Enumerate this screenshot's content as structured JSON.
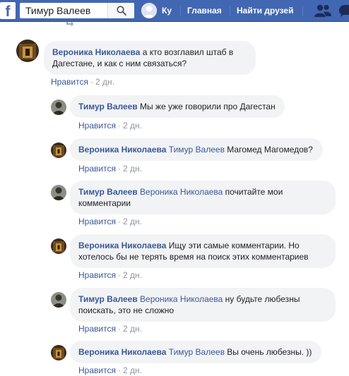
{
  "search": {
    "value": "Тимур Валеев"
  },
  "header": {
    "profile_label": "Ку",
    "home_label": "Главная",
    "find_friends_label": "Найти друзей"
  },
  "colors": {
    "topbar": "#4267b2",
    "link": "#385898",
    "bubble": "#f2f3f5",
    "muted": "#90949c"
  },
  "comments": [
    {
      "author": "Вероника Николаева",
      "mention": "",
      "text": " а кто возглавил штаб в Дагестане, и как с ним связаться?",
      "like": "Нравится",
      "time": "2 дн.",
      "avatar": "avatar-dark-photo"
    },
    {
      "author": "Тимур Валеев",
      "mention": "",
      "text": " Мы же уже говорили про Дагестан",
      "like": "Нравится",
      "time": "2 дн.",
      "avatar": "avatar-man-photo"
    },
    {
      "author": "Вероника Николаева",
      "mention": "Тимур Валеев",
      "text": " Магомед Магомедов?",
      "like": "Нравится",
      "time": "2 дн.",
      "avatar": "avatar-dark-photo"
    },
    {
      "author": "Тимур Валеев",
      "mention": "Вероника Николаева",
      "text": " почитайте мои комментарии",
      "like": "Нравится",
      "time": "2 дн.",
      "avatar": "avatar-man-photo"
    },
    {
      "author": "Вероника Николаева",
      "mention": "",
      "text": " Ищу эти самые комментарии. Но хотелось бы не терять время на поиск этих комментариев",
      "like": "Нравится",
      "time": "2 дн.",
      "avatar": "avatar-dark-photo"
    },
    {
      "author": "Тимур Валеев",
      "mention": "Вероника Николаева",
      "text": " ну будьте любезны поискать, это не сложно",
      "like": "Нравится",
      "time": "2 дн.",
      "avatar": "avatar-man-photo"
    },
    {
      "author": "Вероника Николаева",
      "mention": "Тимур Валеев",
      "text": " Вы очень любезны. ))",
      "like": "Нравится",
      "time": "2 дн.",
      "avatar": "avatar-dark-photo"
    }
  ]
}
